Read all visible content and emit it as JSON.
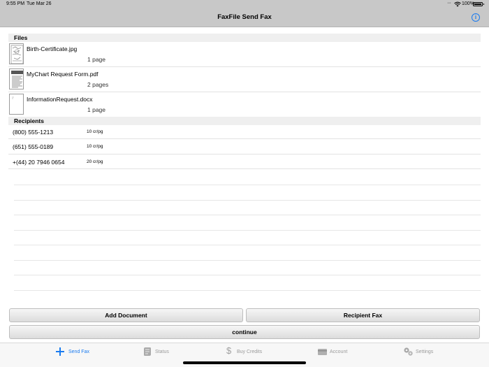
{
  "status_bar": {
    "time": "9:55 PM",
    "date": "Tue Mar 26",
    "battery": "100%"
  },
  "nav": {
    "title": "FaxFile Send Fax"
  },
  "files": {
    "header": "Files",
    "items": [
      {
        "name": "Birth-Certificate.jpg",
        "pages": "1 page"
      },
      {
        "name": "MyChart Request Form.pdf",
        "pages": "2 pages"
      },
      {
        "name": "InformationRequest.docx",
        "pages": "1 page"
      }
    ]
  },
  "recipients": {
    "header": "Recipients",
    "items": [
      {
        "number": "(800) 555-1213",
        "rate": "10 cr/pg"
      },
      {
        "number": "(651) 555-0189",
        "rate": "10 cr/pg"
      },
      {
        "number": "+(44) 20 7946 0654",
        "rate": "20 cr/pg"
      }
    ]
  },
  "buttons": {
    "add_document": "Add Document",
    "recipient_fax": "Recipient Fax",
    "continue": "continue"
  },
  "tabs": [
    {
      "label": "Send Fax",
      "icon": "plus-icon",
      "active": true
    },
    {
      "label": "Status",
      "icon": "scroll-icon",
      "active": false
    },
    {
      "label": "Buy Credits",
      "icon": "dollar-icon",
      "active": false
    },
    {
      "label": "Account",
      "icon": "card-icon",
      "active": false
    },
    {
      "label": "Settings",
      "icon": "gears-icon",
      "active": false
    }
  ],
  "colors": {
    "accent": "#1a7bf0",
    "bar": "#c8c8c8"
  }
}
